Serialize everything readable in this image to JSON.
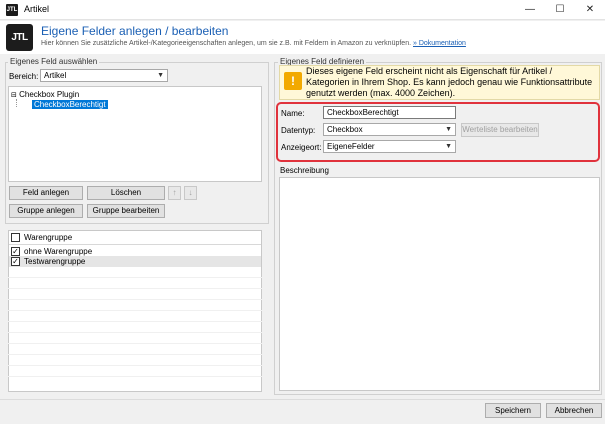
{
  "window": {
    "title": "Artikel",
    "icon_text": "JTL"
  },
  "header": {
    "logo_text": "JTL",
    "title": "Eigene Felder anlegen / bearbeiten",
    "subtitle": "Hier können Sie zusätzliche Artikel-/Kategorieeigenschaften anlegen, um sie z.B. mit Feldern in Amazon zu verknüpfen.",
    "link": "» Dokumentation"
  },
  "left": {
    "group_title": "Eigenes Feld auswählen",
    "bereich_label": "Bereich:",
    "bereich_value": "Artikel",
    "tree": {
      "parent": "Checkbox Plugin",
      "child": "CheckboxBerechtigt"
    },
    "buttons": {
      "feld_anlegen": "Feld anlegen",
      "loeschen": "Löschen",
      "up": "↑",
      "down": "↓",
      "gruppe_anlegen": "Gruppe anlegen",
      "gruppe_bearbeiten": "Gruppe bearbeiten"
    },
    "groups": [
      {
        "label": "Warengruppe",
        "checked": false
      },
      {
        "label": "ohne Warengruppe",
        "checked": true
      },
      {
        "label": "Testwarengruppe",
        "checked": true
      }
    ]
  },
  "right": {
    "group_title": "Eigenes Feld definieren",
    "warning_icon": "exclamation-icon",
    "warning_text": "Dieses eigene Feld erscheint nicht als Eigenschaft für Artikel / Kategorien in Ihrem Shop. Es kann jedoch genau wie Funktionsattribute genutzt werden (max. 4000 Zeichen).",
    "name_label": "Name:",
    "name_value": "CheckboxBerechtigt",
    "datentyp_label": "Datentyp:",
    "datentyp_value": "Checkbox",
    "werteliste_button": "Werteliste bearbeiten",
    "anzeigeort_label": "Anzeigeort:",
    "anzeigeort_value": "EigeneFelder",
    "beschreibung_label": "Beschreibung"
  },
  "footer": {
    "save": "Speichern",
    "cancel": "Abbrechen"
  },
  "colors": {
    "accent": "#1a5fb4",
    "highlight_border": "#e0323c",
    "warning_bg": "#fff8d8",
    "selection": "#0078d7"
  }
}
